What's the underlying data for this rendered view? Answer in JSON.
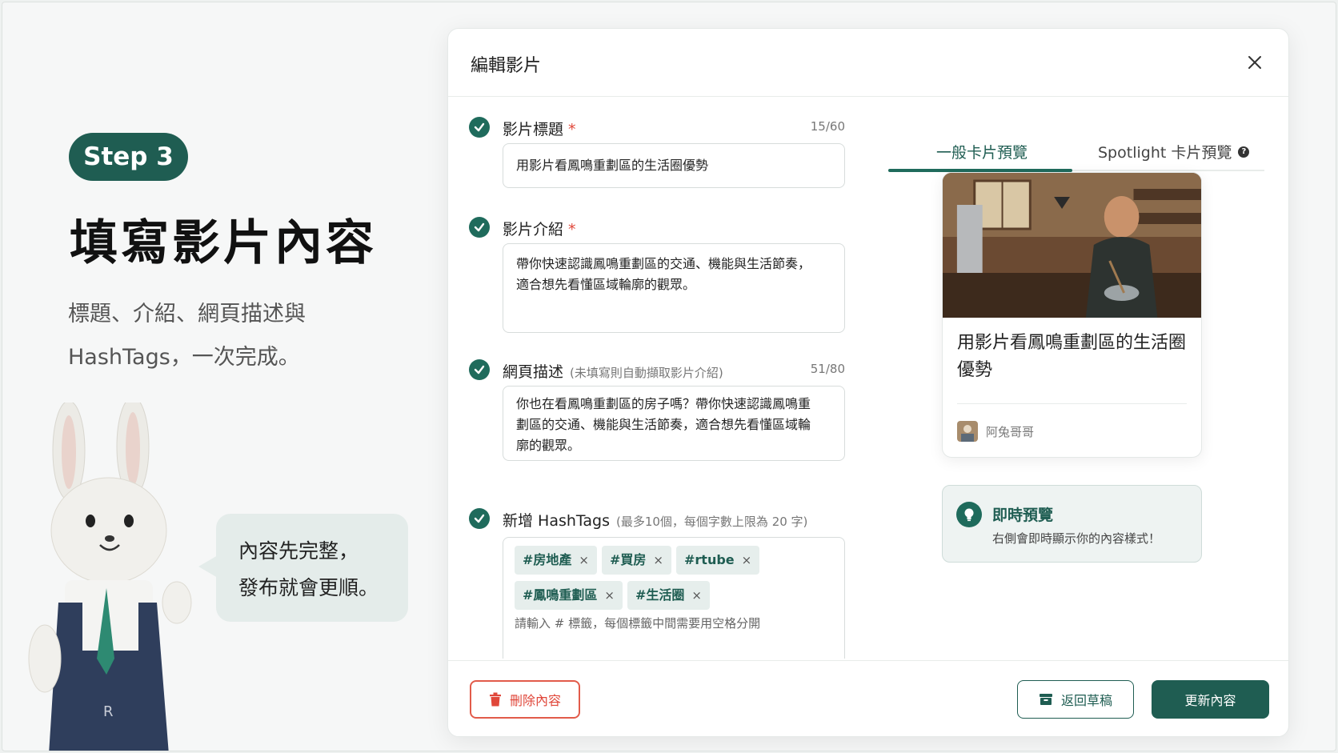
{
  "promo": {
    "step": "Step 3",
    "title": "填寫影片內容",
    "subtitle_line1": "標題、介紹、網頁描述與",
    "subtitle_line2": "HashTags，一次完成。",
    "bubble_line1": "內容先完整，",
    "bubble_line2": "發布就會更順。"
  },
  "modal": {
    "title": "編輯影片",
    "fields": {
      "title": {
        "label": "影片標題",
        "required": "*",
        "counter": "15/60",
        "value": "用影片看鳳鳴重劃區的生活圈優勢"
      },
      "intro": {
        "label": "影片介紹",
        "required": "*",
        "line1": "帶你快速認識鳳鳴重劃區的交通、機能與生活節奏，",
        "line2": "適合想先看懂區域輪廓的觀眾。"
      },
      "desc": {
        "label": "網頁描述",
        "hint": "(未填寫則自動擷取影片介紹)",
        "counter": "51/80",
        "line1": "你也在看鳳鳴重劃區的房子嗎？帶你快速認識鳳鳴重",
        "line2": "劃區的交通、機能與生活節奏，適合想先看懂區域輪",
        "line3": "廓的觀眾。"
      },
      "hashtags": {
        "label": "新增 HashTags",
        "hint": "(最多10個，每個字數上限為 20 字)",
        "tags": [
          "#房地產",
          "#買房",
          "#rtube",
          "#鳳鳴重劃區",
          "#生活圈"
        ],
        "remove": "×",
        "placeholder": "請輸入 # 標籤，每個標籤中間需要用空格分開"
      }
    },
    "buttons": {
      "delete": "刪除內容",
      "draft": "返回草稿",
      "update": "更新內容"
    }
  },
  "preview": {
    "tabs": {
      "general": "一般卡片預覽",
      "spotlight": "Spotlight 卡片預覽",
      "help": "?"
    },
    "card": {
      "title": "用影片看鳳鳴重劃區的生活圈優勢",
      "author": "阿兔哥哥"
    },
    "live": {
      "title": "即時預覽",
      "text": "右側會即時顯示你的內容樣式！"
    }
  },
  "colors": {
    "brand": "#1f5d52",
    "danger": "#e0473a",
    "panel": "#eef3f2"
  }
}
